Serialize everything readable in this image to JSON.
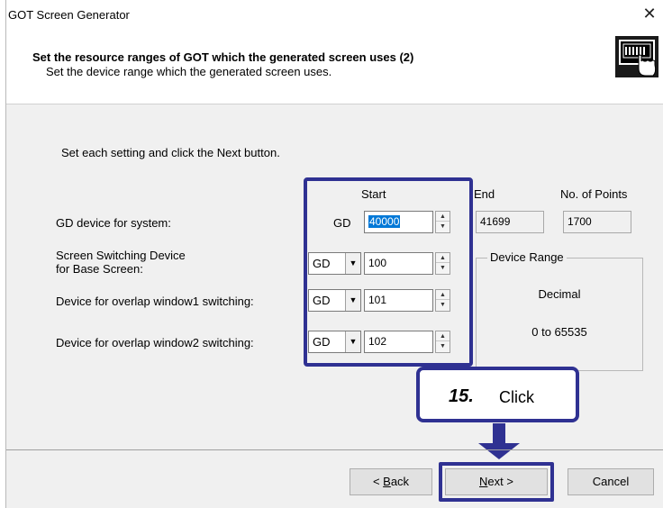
{
  "window": {
    "title": "GOT Screen Generator",
    "close_glyph": "✕"
  },
  "header": {
    "title": "Set the resource ranges of GOT which the generated screen uses (2)",
    "subtitle": "Set the device range which the generated screen uses.",
    "icon": "touch-panel-hand-icon"
  },
  "body": {
    "instruction": "Set each setting and click the Next button.",
    "columns": {
      "start": "Start",
      "end": "End",
      "points": "No. of Points"
    },
    "rows": [
      {
        "label": "GD device for system:",
        "prefix": "GD",
        "start": "40000",
        "end": "41699",
        "points": "1700"
      },
      {
        "label_line1": "Screen Switching Device",
        "label_line2": "for Base Screen:",
        "device": "GD",
        "start": "100"
      },
      {
        "label": "Device for overlap window1 switching:",
        "device": "GD",
        "start": "101"
      },
      {
        "label": "Device for overlap window2 switching:",
        "device": "GD",
        "start": "102"
      }
    ],
    "device_range": {
      "title": "Device Range",
      "radix": "Decimal",
      "range": "0 to 65535"
    }
  },
  "callout": {
    "step": "15.",
    "action": "Click"
  },
  "buttons": {
    "back_mnemonic": "B",
    "back_rest": "ack",
    "back_prefix": "< ",
    "next_mnemonic": "N",
    "next_rest": "ext >",
    "cancel": "Cancel"
  },
  "colors": {
    "annotation": "#2f3192",
    "selection": "#0078d7"
  }
}
